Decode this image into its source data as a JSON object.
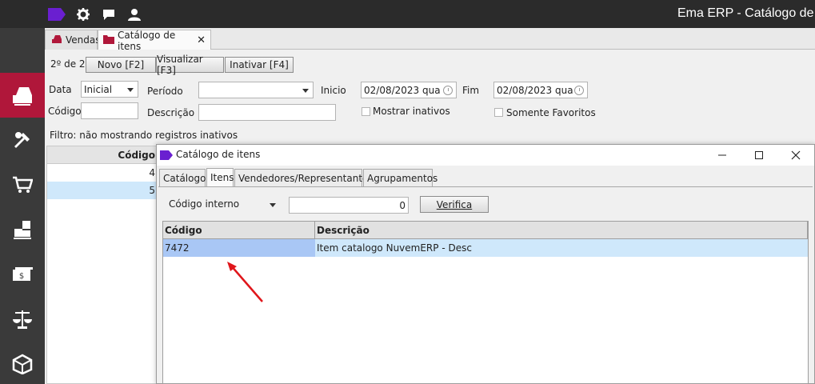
{
  "app": {
    "title": "Ema ERP - Catálogo de ite"
  },
  "topbar": {
    "icons": [
      "brand-tag-icon",
      "gear-icon",
      "chat-icon",
      "user-icon"
    ],
    "colors": {
      "bar": "#2b2b2b",
      "brand": "#6a1fd0"
    }
  },
  "sidebar": {
    "items": [
      "sales-register-icon",
      "tools-icon",
      "cart-icon",
      "warehouse-icon",
      "cash-icon",
      "scales-icon",
      "box-icon"
    ],
    "active_color": "#b0173a"
  },
  "tabs": [
    {
      "label": "Vendas"
    },
    {
      "label": "Catálogo de itens",
      "close": "✕"
    }
  ],
  "toolbar": {
    "pager": "2º de 2",
    "new_label": "Novo [F2]",
    "view_label": "Visualizar [F3]",
    "inactivate_label": "Inativar [F4]"
  },
  "filters": {
    "data_label": "Data",
    "data_value": "Inicial",
    "period_label": "Período",
    "period_value": "",
    "start_label": "Inicio",
    "start_value": "02/08/2023 qua",
    "end_label": "Fim",
    "end_value": "02/08/2023 qua",
    "code_label": "Código",
    "code_value": "",
    "desc_label": "Descrição",
    "desc_value": "",
    "show_inactive_label": "Mostrar inativos",
    "favorites_label": "Somente Favoritos",
    "filter_text": "Filtro: não mostrando registros inativos"
  },
  "bg_grid": {
    "header": "Código",
    "rows": [
      "4",
      "5"
    ]
  },
  "dialog": {
    "title": "Catálogo de itens",
    "tabs": [
      "Catálogo",
      "Itens",
      "Vendedores/Representantes",
      "Agrupamentos"
    ],
    "active_tab": "Itens",
    "search_field_label": "Código interno",
    "search_value": "0",
    "verify_label": "Verifica",
    "columns": [
      "Código",
      "Descrição"
    ],
    "rows": [
      {
        "code": "7472",
        "description": "Item catalogo NuvemERP - Desc"
      }
    ],
    "selected_row_color": "#cfe8fb"
  }
}
